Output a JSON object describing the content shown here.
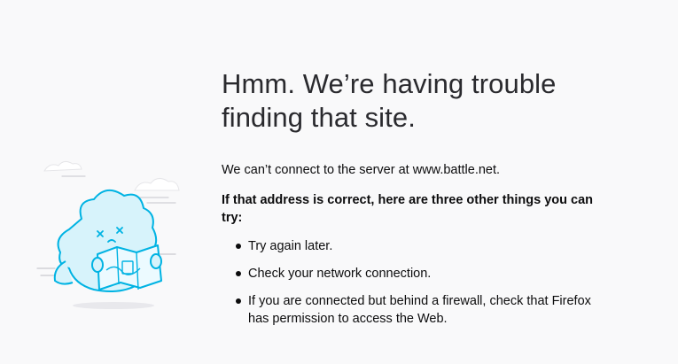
{
  "error": {
    "title": "Hmm. We’re having trouble finding that site.",
    "description": "We can’t connect to the server at www.battle.net.",
    "subheading": "If that address is correct, here are three other things you can try:",
    "tips": [
      "Try again later.",
      "Check your network connection.",
      "If you are connected but behind a firewall, check that Firefox has permission to access the Web."
    ]
  },
  "illustration": {
    "icon": "lost-map-character-illustration",
    "accent_color": "#00b3e3",
    "fill_color": "#d7f3fb"
  }
}
